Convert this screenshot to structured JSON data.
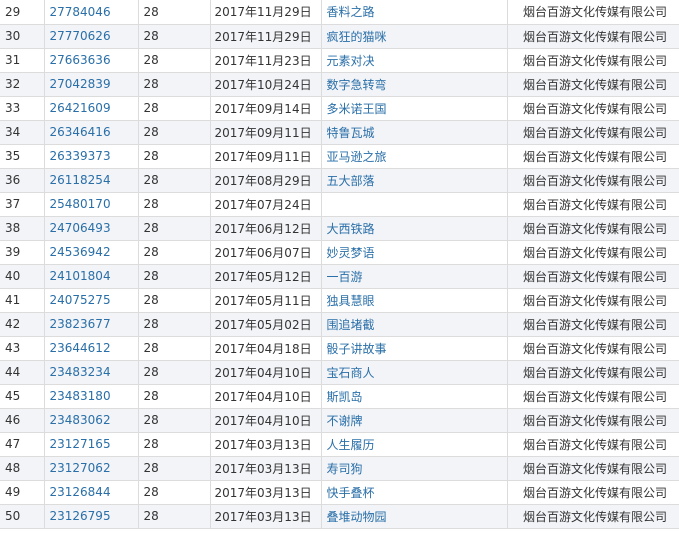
{
  "link_color": "#2a6fa8",
  "rows": [
    {
      "no": "29",
      "reg": "27784046",
      "cls": "28",
      "date": "2017年11月29日",
      "name": "香料之路",
      "company": "烟台百游文化传媒有限公司"
    },
    {
      "no": "30",
      "reg": "27770626",
      "cls": "28",
      "date": "2017年11月29日",
      "name": "疯狂的猫咪",
      "company": "烟台百游文化传媒有限公司"
    },
    {
      "no": "31",
      "reg": "27663636",
      "cls": "28",
      "date": "2017年11月23日",
      "name": "元素对决",
      "company": "烟台百游文化传媒有限公司"
    },
    {
      "no": "32",
      "reg": "27042839",
      "cls": "28",
      "date": "2017年10月24日",
      "name": "数字急转弯",
      "company": "烟台百游文化传媒有限公司"
    },
    {
      "no": "33",
      "reg": "26421609",
      "cls": "28",
      "date": "2017年09月14日",
      "name": "多米诺王国",
      "company": "烟台百游文化传媒有限公司"
    },
    {
      "no": "34",
      "reg": "26346416",
      "cls": "28",
      "date": "2017年09月11日",
      "name": "特鲁瓦城",
      "company": "烟台百游文化传媒有限公司"
    },
    {
      "no": "35",
      "reg": "26339373",
      "cls": "28",
      "date": "2017年09月11日",
      "name": "亚马逊之旅",
      "company": "烟台百游文化传媒有限公司"
    },
    {
      "no": "36",
      "reg": "26118254",
      "cls": "28",
      "date": "2017年08月29日",
      "name": "五大部落",
      "company": "烟台百游文化传媒有限公司"
    },
    {
      "no": "37",
      "reg": "25480170",
      "cls": "28",
      "date": "2017年07月24日",
      "name": "",
      "company": "烟台百游文化传媒有限公司"
    },
    {
      "no": "38",
      "reg": "24706493",
      "cls": "28",
      "date": "2017年06月12日",
      "name": "大西铁路",
      "company": "烟台百游文化传媒有限公司"
    },
    {
      "no": "39",
      "reg": "24536942",
      "cls": "28",
      "date": "2017年06月07日",
      "name": "妙灵梦语",
      "company": "烟台百游文化传媒有限公司"
    },
    {
      "no": "40",
      "reg": "24101804",
      "cls": "28",
      "date": "2017年05月12日",
      "name": "一百游",
      "company": "烟台百游文化传媒有限公司"
    },
    {
      "no": "41",
      "reg": "24075275",
      "cls": "28",
      "date": "2017年05月11日",
      "name": "独具慧眼",
      "company": "烟台百游文化传媒有限公司"
    },
    {
      "no": "42",
      "reg": "23823677",
      "cls": "28",
      "date": "2017年05月02日",
      "name": "围追堵截",
      "company": "烟台百游文化传媒有限公司"
    },
    {
      "no": "43",
      "reg": "23644612",
      "cls": "28",
      "date": "2017年04月18日",
      "name": "骰子讲故事",
      "company": "烟台百游文化传媒有限公司"
    },
    {
      "no": "44",
      "reg": "23483234",
      "cls": "28",
      "date": "2017年04月10日",
      "name": "宝石商人",
      "company": "烟台百游文化传媒有限公司"
    },
    {
      "no": "45",
      "reg": "23483180",
      "cls": "28",
      "date": "2017年04月10日",
      "name": "斯凯岛",
      "company": "烟台百游文化传媒有限公司"
    },
    {
      "no": "46",
      "reg": "23483062",
      "cls": "28",
      "date": "2017年04月10日",
      "name": "不谢牌",
      "company": "烟台百游文化传媒有限公司"
    },
    {
      "no": "47",
      "reg": "23127165",
      "cls": "28",
      "date": "2017年03月13日",
      "name": "人生履历",
      "company": "烟台百游文化传媒有限公司"
    },
    {
      "no": "48",
      "reg": "23127062",
      "cls": "28",
      "date": "2017年03月13日",
      "name": "寿司狗",
      "company": "烟台百游文化传媒有限公司"
    },
    {
      "no": "49",
      "reg": "23126844",
      "cls": "28",
      "date": "2017年03月13日",
      "name": "快手叠杯",
      "company": "烟台百游文化传媒有限公司"
    },
    {
      "no": "50",
      "reg": "23126795",
      "cls": "28",
      "date": "2017年03月13日",
      "name": "叠堆动物园",
      "company": "烟台百游文化传媒有限公司"
    }
  ]
}
